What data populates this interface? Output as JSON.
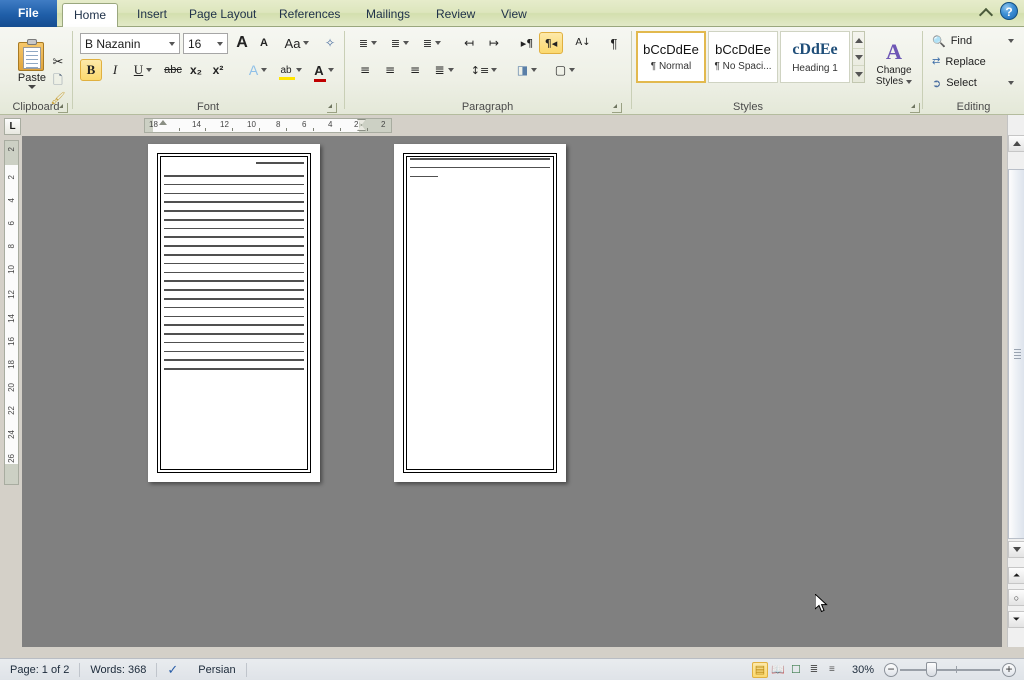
{
  "window": {
    "help_label": "?",
    "collapse_ribbon_label": "^"
  },
  "tabs": [
    {
      "id": "file",
      "label": "File"
    },
    {
      "id": "home",
      "label": "Home"
    },
    {
      "id": "insert",
      "label": "Insert"
    },
    {
      "id": "pagelayout",
      "label": "Page Layout"
    },
    {
      "id": "references",
      "label": "References"
    },
    {
      "id": "mailings",
      "label": "Mailings"
    },
    {
      "id": "review",
      "label": "Review"
    },
    {
      "id": "view",
      "label": "View"
    }
  ],
  "ribbon": {
    "groups": {
      "clipboard": {
        "label": "Clipboard",
        "paste_label": "Paste",
        "cut_label": "Cut",
        "copy_label": "Copy",
        "format_painter_label": "Format Painter"
      },
      "font": {
        "label": "Font",
        "font_name": "B Nazanin",
        "font_size": "16",
        "grow_font_label": "A",
        "shrink_font_label": "A",
        "change_case_label": "Aa",
        "clear_formatting_label": "Clear Formatting",
        "bold_label": "B",
        "italic_label": "I",
        "underline_label": "U",
        "strikethrough_label": "abc",
        "subscript_label": "x₂",
        "superscript_label": "x²",
        "text_effects_label": "A",
        "highlight_label": "ab",
        "font_color_label": "A",
        "highlight_color": "#ffe400",
        "font_color": "#c00000"
      },
      "paragraph": {
        "label": "Paragraph",
        "bullets_label": "Bullets",
        "numbering_label": "Numbering",
        "multilevel_label": "Multilevel List",
        "decrease_indent_label": "Decrease Indent",
        "increase_indent_label": "Increase Indent",
        "ltr_label": "Left-to-Right",
        "rtl_label": "Right-to-Left",
        "sort_label": "Sort",
        "show_marks_label": "¶",
        "align_left_label": "Align Left",
        "align_center_label": "Center",
        "align_right_label": "Align Right",
        "justify_label": "Justify",
        "line_spacing_label": "Line and Paragraph Spacing",
        "shading_label": "Shading",
        "borders_label": "Borders"
      },
      "styles": {
        "label": "Styles",
        "items": [
          {
            "preview": "bCcDdEe",
            "name": "¶ Normal",
            "selected": true
          },
          {
            "preview": "bCcDdEe",
            "name": "¶ No Spaci...",
            "selected": false
          },
          {
            "preview": "cDdEe",
            "name": "Heading 1",
            "selected": false
          }
        ],
        "change_styles_label_1": "Change",
        "change_styles_label_2": "Styles"
      },
      "editing": {
        "label": "Editing",
        "find_label": "Find",
        "replace_label": "Replace",
        "select_label": "Select"
      }
    }
  },
  "rulers": {
    "tab_selector_label": "L",
    "horizontal_ticks": [
      "18",
      "14",
      "12",
      "10",
      "8",
      "6",
      "4",
      "2",
      "2"
    ],
    "vertical_ticks": [
      "2",
      "2",
      "4",
      "6",
      "8",
      "10",
      "12",
      "14",
      "16",
      "18",
      "20",
      "22",
      "24",
      "26"
    ]
  },
  "document": {
    "pages": [
      {
        "number": 1,
        "has_title_line": true,
        "body_line_widths": [
          100,
          100,
          100,
          100,
          100,
          100,
          100,
          100,
          100,
          100,
          100,
          100,
          100,
          100,
          100,
          100,
          100,
          100,
          100,
          100,
          100,
          100,
          100
        ]
      },
      {
        "number": 2,
        "has_title_line": false,
        "body_line_widths": [
          100,
          100,
          20
        ]
      }
    ]
  },
  "status": {
    "page_label": "Page: 1 of 2",
    "words_label": "Words: 368",
    "proofing_label": "Proofing Errors",
    "language_label": "Persian",
    "zoom_label": "30%",
    "zoom_out_label": "−",
    "zoom_in_label": "+",
    "views": [
      {
        "id": "print-layout",
        "label": "Print Layout",
        "selected": true
      },
      {
        "id": "full-screen-reading",
        "label": "Full Screen Reading",
        "selected": false
      },
      {
        "id": "web-layout",
        "label": "Web Layout",
        "selected": false
      },
      {
        "id": "outline",
        "label": "Outline",
        "selected": false
      },
      {
        "id": "draft",
        "label": "Draft",
        "selected": false
      }
    ]
  },
  "scrollbar": {
    "previous_page_label": "Previous Page",
    "select_browse_object_label": "Select Browse Object",
    "next_page_label": "Next Page",
    "ruler_toggle_label": "View Ruler"
  }
}
